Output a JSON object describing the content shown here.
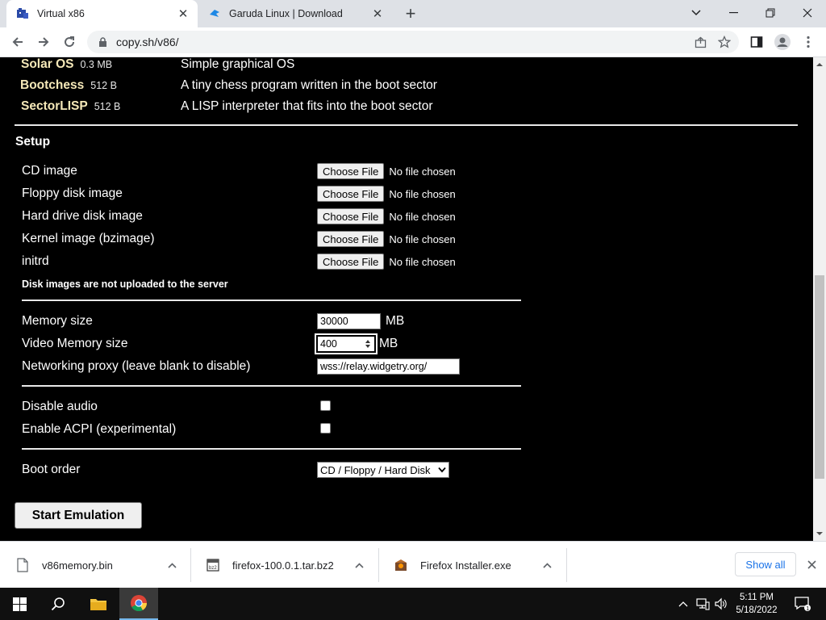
{
  "browser": {
    "tabs": [
      {
        "title": "Virtual x86",
        "active": true,
        "favicon": "v86-icon"
      },
      {
        "title": "Garuda Linux | Download",
        "active": false,
        "favicon": "garuda-icon"
      }
    ],
    "new_tab_label": "+",
    "url": "copy.sh/v86/"
  },
  "os_list": [
    {
      "name": "Solar OS",
      "size": "0.3 MB",
      "desc": "Simple graphical OS"
    },
    {
      "name": "Bootchess",
      "size": "512 B",
      "desc": "A tiny chess program written in the boot sector"
    },
    {
      "name": "SectorLISP",
      "size": "512 B",
      "desc": "A LISP interpreter that fits into the boot sector"
    }
  ],
  "setup": {
    "heading": "Setup",
    "file_inputs": [
      {
        "label": "CD image",
        "button": "Choose File",
        "status": "No file chosen"
      },
      {
        "label": "Floppy disk image",
        "button": "Choose File",
        "status": "No file chosen"
      },
      {
        "label": "Hard drive disk image",
        "button": "Choose File",
        "status": "No file chosen"
      },
      {
        "label": "Kernel image (bzimage)",
        "button": "Choose File",
        "status": "No file chosen"
      },
      {
        "label": "initrd",
        "button": "Choose File",
        "status": "No file chosen"
      }
    ],
    "disk_note": "Disk images are not uploaded to the server",
    "memory": {
      "label": "Memory size",
      "value": "30000",
      "unit": "MB"
    },
    "video_memory": {
      "label": "Video Memory size",
      "value": "400",
      "unit": "MB"
    },
    "proxy": {
      "label": "Networking proxy (leave blank to disable)",
      "value": "wss://relay.widgetry.org/"
    },
    "disable_audio": {
      "label": "Disable audio",
      "checked": false
    },
    "enable_acpi": {
      "label": "Enable ACPI (experimental)",
      "checked": false
    },
    "boot_order": {
      "label": "Boot order",
      "selected": "CD / Floppy / Hard Disk"
    },
    "start_button": "Start Emulation"
  },
  "downloads": {
    "items": [
      {
        "name": "v86memory.bin",
        "icon": "file-icon"
      },
      {
        "name": "firefox-100.0.1.tar.bz2",
        "icon": "archive-icon"
      },
      {
        "name": "Firefox Installer.exe",
        "icon": "installer-icon"
      }
    ],
    "show_all": "Show all"
  },
  "taskbar": {
    "time": "5:11 PM",
    "date": "5/18/2022"
  },
  "colors": {
    "page_bg": "#000000",
    "os_name": "#f5e8b8",
    "link_blue": "#1a73e8"
  }
}
